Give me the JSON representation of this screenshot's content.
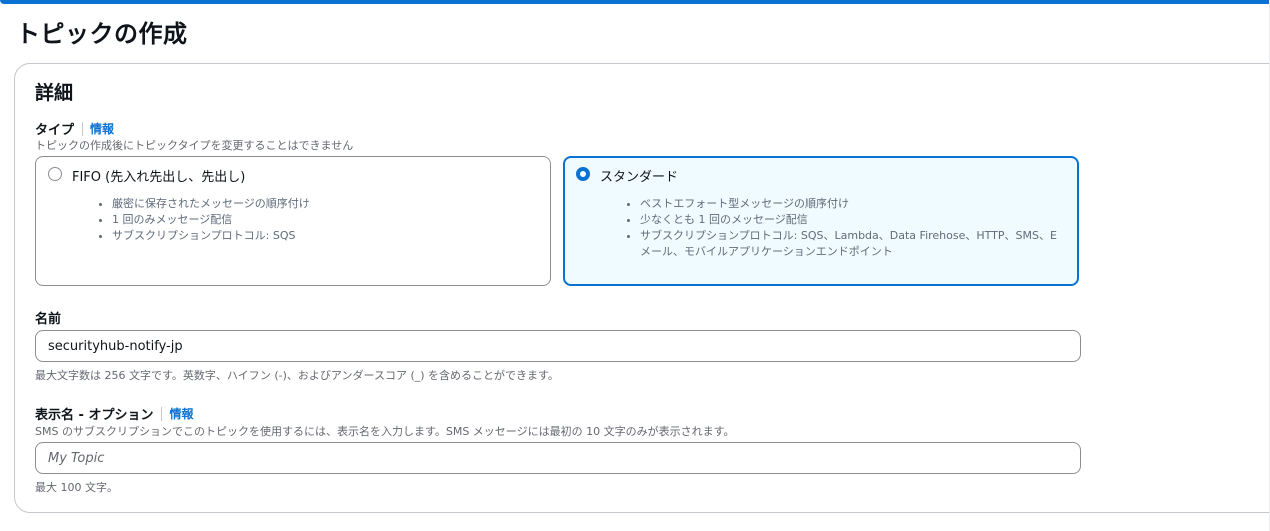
{
  "page": {
    "title": "トピックの作成"
  },
  "details": {
    "heading": "詳細",
    "type": {
      "label": "タイプ",
      "info": "情報",
      "description": "トピックの作成後にトピックタイプを変更することはできません",
      "options": [
        {
          "title": "FIFO (先入れ先出し、先出し)",
          "selected": false,
          "bullets": [
            "厳密に保存されたメッセージの順序付け",
            "1 回のみメッセージ配信",
            "サブスクリプションプロトコル: SQS"
          ]
        },
        {
          "title": "スタンダード",
          "selected": true,
          "bullets": [
            "ベストエフォート型メッセージの順序付け",
            "少なくとも 1 回のメッセージ配信",
            "サブスクリプションプロトコル: SQS、Lambda、Data Firehose、HTTP、SMS、E メール、モバイルアプリケーションエンドポイント"
          ]
        }
      ]
    },
    "name": {
      "label": "名前",
      "value": "securityhub-notify-jp",
      "hint": "最大文字数は 256 文字です。英数字、ハイフン (-)、およびアンダースコア (_) を含めることができます。"
    },
    "display_name": {
      "label": "表示名 - オプション",
      "info": "情報",
      "description": "SMS のサブスクリプションでこのトピックを使用するには、表示名を入力します。SMS メッセージには最初の 10 文字のみが表示されます。",
      "placeholder": "My Topic",
      "value": "",
      "hint": "最大 100 文字。"
    }
  },
  "colors": {
    "accent": "#0972d3",
    "selected_tile_bg": "#f0fbff",
    "border": "#8c8c94",
    "muted_text": "#656871"
  }
}
